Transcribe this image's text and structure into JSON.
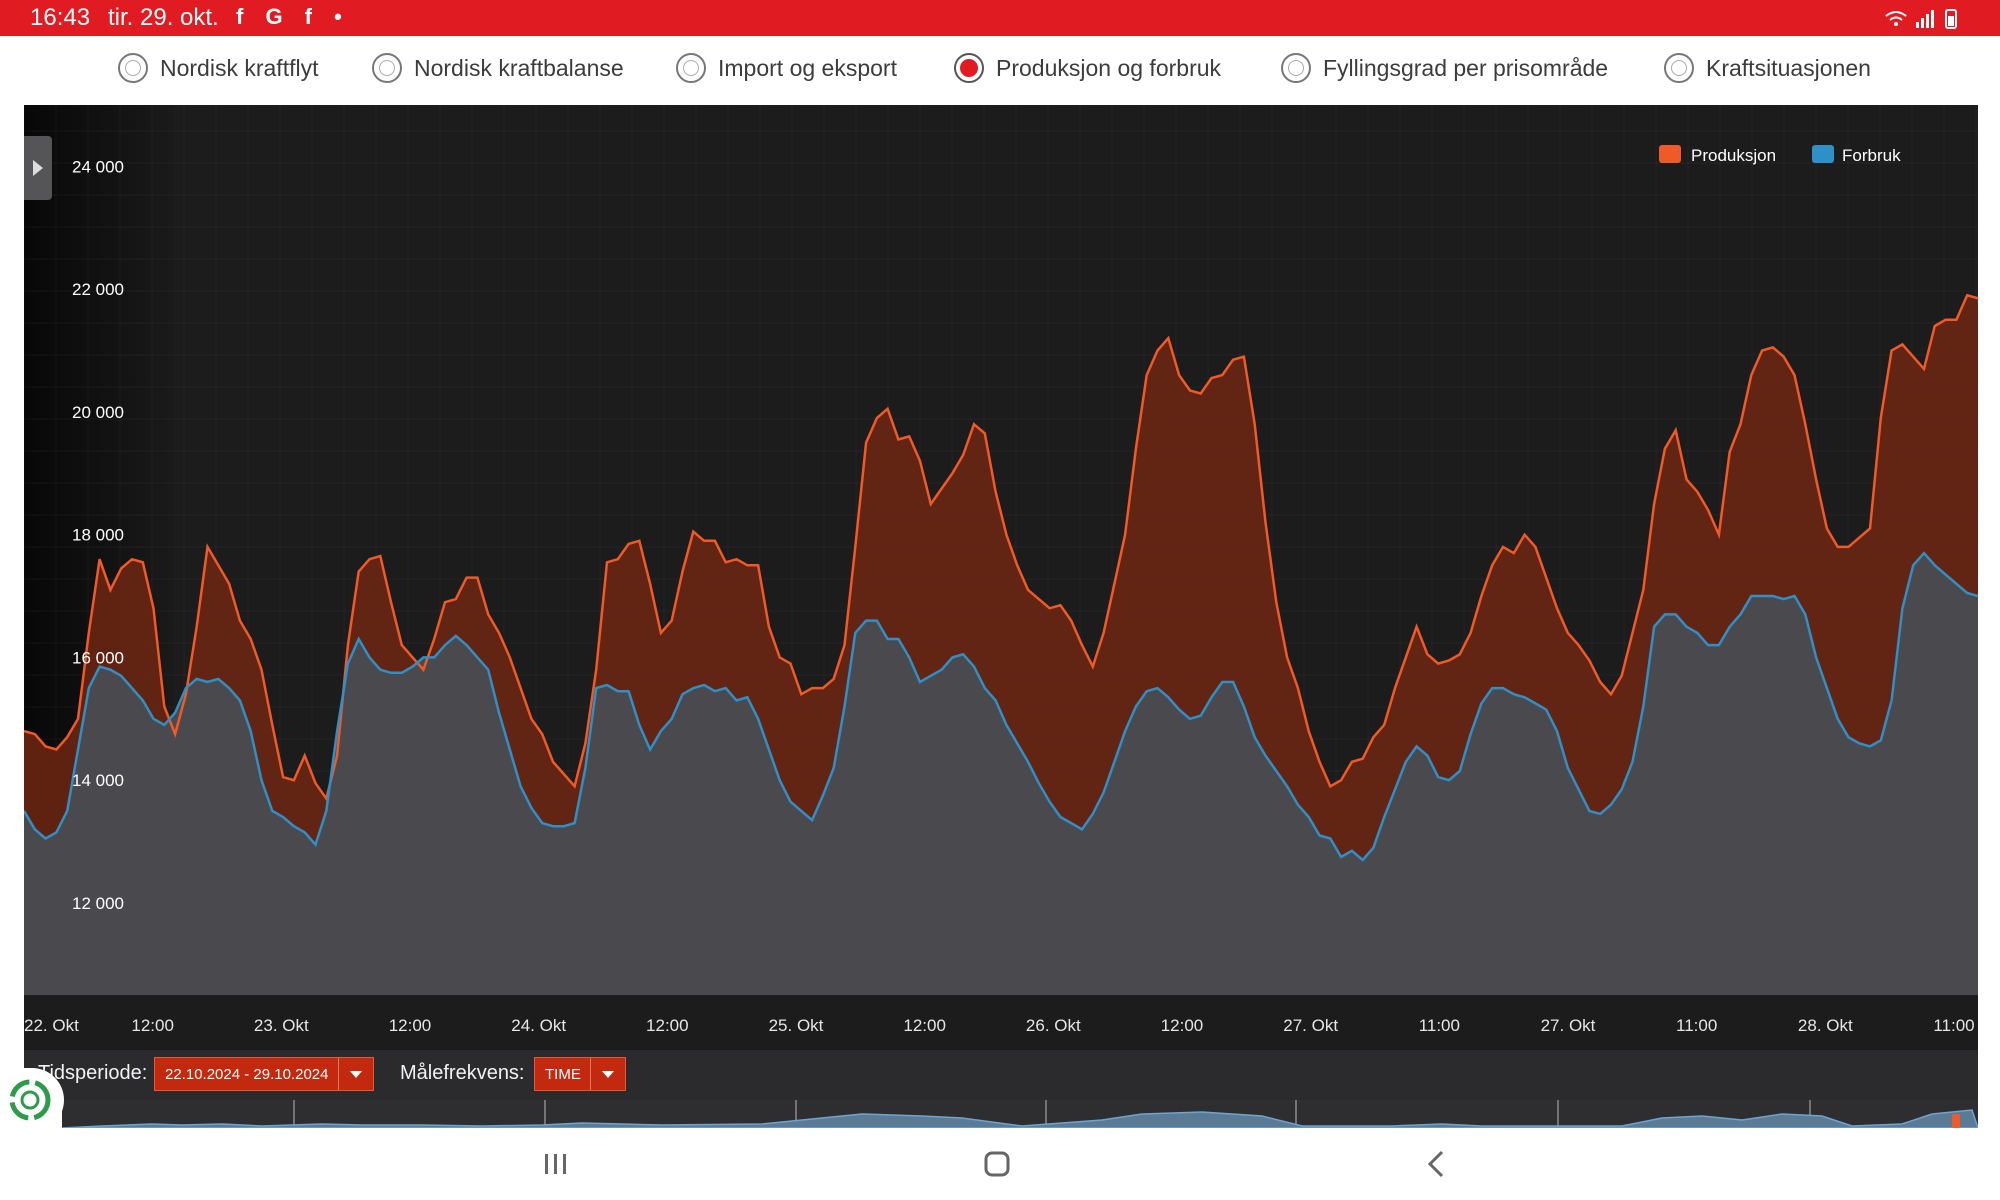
{
  "status_bar": {
    "time": "16:43",
    "date": "tir. 29. okt.",
    "notification_icons": "f G f •"
  },
  "radio_options": [
    {
      "label": "Nordisk kraftflyt",
      "selected": false
    },
    {
      "label": "Nordisk kraftbalanse",
      "selected": false
    },
    {
      "label": "Import og eksport",
      "selected": false
    },
    {
      "label": "Produksjon og forbruk",
      "selected": true
    },
    {
      "label": "Fyllingsgrad per prisområde",
      "selected": false
    },
    {
      "label": "Kraftsituasjonen",
      "selected": false
    }
  ],
  "controls": {
    "period_label": "Tidsperiode:",
    "period_value": "22.10.2024 - 29.10.2024",
    "frequency_label": "Målefrekvens:",
    "frequency_value": "TIME"
  },
  "colors": {
    "production": "#f05a28",
    "consumption": "#2f8fc7",
    "accent": "#e11b22"
  },
  "chart_data": {
    "type": "area",
    "ylim": [
      10500,
      25000
    ],
    "yticks": [
      12000,
      14000,
      16000,
      18000,
      20000,
      22000,
      24000
    ],
    "ytick_labels": [
      "12 000",
      "14 000",
      "16 000",
      "18 000",
      "20 000",
      "22 000",
      "24 000"
    ],
    "xtick_labels": [
      "22. Okt",
      "12:00",
      "23. Okt",
      "12:00",
      "24. Okt",
      "12:00",
      "25. Okt",
      "12:00",
      "26. Okt",
      "12:00",
      "27. Okt",
      "11:00",
      "27. Okt",
      "11:00",
      "28. Okt",
      "11:00"
    ],
    "x_start": "22.10.2024 00:00",
    "x_step": "1 time",
    "legend_position": "top-right",
    "grid": true,
    "series": [
      {
        "name": "Produksjon",
        "color": "#f05a28",
        "values": [
          14800,
          14750,
          14550,
          14500,
          14700,
          15000,
          16400,
          17600,
          17100,
          17450,
          17600,
          17550,
          16800,
          15200,
          14750,
          15400,
          16500,
          17800,
          17500,
          17200,
          16600,
          16300,
          15800,
          14900,
          14050,
          14000,
          14400,
          13950,
          13700,
          14400,
          16200,
          17400,
          17600,
          17650,
          16900,
          16200,
          16000,
          15800,
          16300,
          16900,
          16950,
          17300,
          17300,
          16700,
          16400,
          16000,
          15500,
          15000,
          14750,
          14300,
          14100,
          13900,
          14600,
          15800,
          17550,
          17600,
          17850,
          17900,
          17200,
          16400,
          16600,
          17400,
          18050,
          17900,
          17900,
          17550,
          17600,
          17500,
          17500,
          16500,
          16000,
          15900,
          15400,
          15500,
          15500,
          15650,
          16200,
          17800,
          19500,
          19900,
          20050,
          19550,
          19600,
          19200,
          18500,
          18750,
          19000,
          19300,
          19800,
          19650,
          18700,
          18000,
          17500,
          17100,
          16950,
          16800,
          16850,
          16600,
          16200,
          15850,
          16400,
          17200,
          18000,
          19400,
          20600,
          21000,
          21200,
          20600,
          20350,
          20300,
          20550,
          20600,
          20850,
          20900,
          19800,
          18200,
          16900,
          16000,
          15500,
          14800,
          14300,
          13900,
          14000,
          14300,
          14350,
          14700,
          14900,
          15500,
          16000,
          16500,
          16050,
          15900,
          15950,
          16050,
          16400,
          17000,
          17500,
          17800,
          17700,
          18000,
          17800,
          17300,
          16800,
          16400,
          16200,
          15950,
          15600,
          15400,
          15700,
          16400,
          17100,
          18500,
          19400,
          19700,
          18900,
          18700,
          18400,
          18000,
          19350,
          19800,
          20600,
          21000,
          21050,
          20900,
          20600,
          19800,
          18900,
          18100,
          17800,
          17800,
          17950,
          18100,
          19900,
          21000,
          21100,
          20900,
          20700,
          21400,
          21500,
          21500,
          21900,
          21850
        ]
      },
      {
        "name": "Forbruk",
        "color": "#2f8fc7",
        "values": [
          13500,
          13200,
          13050,
          13150,
          13500,
          14500,
          15500,
          15850,
          15800,
          15700,
          15500,
          15300,
          15000,
          14900,
          15100,
          15500,
          15650,
          15600,
          15650,
          15500,
          15300,
          14800,
          14000,
          13500,
          13400,
          13250,
          13150,
          12950,
          13500,
          14800,
          15900,
          16300,
          16000,
          15800,
          15750,
          15750,
          15850,
          16000,
          16000,
          16200,
          16350,
          16200,
          16000,
          15800,
          15100,
          14500,
          13900,
          13550,
          13300,
          13250,
          13250,
          13300,
          14200,
          15500,
          15550,
          15450,
          15450,
          14900,
          14500,
          14800,
          15000,
          15400,
          15500,
          15550,
          15450,
          15500,
          15300,
          15350,
          15000,
          14500,
          14000,
          13650,
          13500,
          13350,
          13750,
          14200,
          15200,
          16400,
          16600,
          16600,
          16300,
          16300,
          16000,
          15600,
          15700,
          15800,
          16000,
          16050,
          15850,
          15500,
          15300,
          14900,
          14600,
          14300,
          13950,
          13650,
          13400,
          13300,
          13200,
          13450,
          13800,
          14300,
          14800,
          15200,
          15450,
          15500,
          15350,
          15150,
          15000,
          15050,
          15350,
          15600,
          15600,
          15200,
          14700,
          14400,
          14150,
          13900,
          13600,
          13400,
          13100,
          13050,
          12750,
          12850,
          12700,
          12900,
          13400,
          13850,
          14300,
          14550,
          14400,
          14050,
          14000,
          14150,
          14750,
          15250,
          15500,
          15500,
          15400,
          15350,
          15250,
          15150,
          14800,
          14200,
          13850,
          13500,
          13450,
          13600,
          13850,
          14300,
          15200,
          16500,
          16700,
          16700,
          16500,
          16400,
          16200,
          16200,
          16500,
          16700,
          17000,
          17000,
          17000,
          16950,
          17000,
          16700,
          16000,
          15500,
          15000,
          14700,
          14600,
          14550,
          14650,
          15300,
          16800,
          17500,
          17700,
          17500,
          17350,
          17200,
          17050,
          17000
        ]
      }
    ]
  }
}
